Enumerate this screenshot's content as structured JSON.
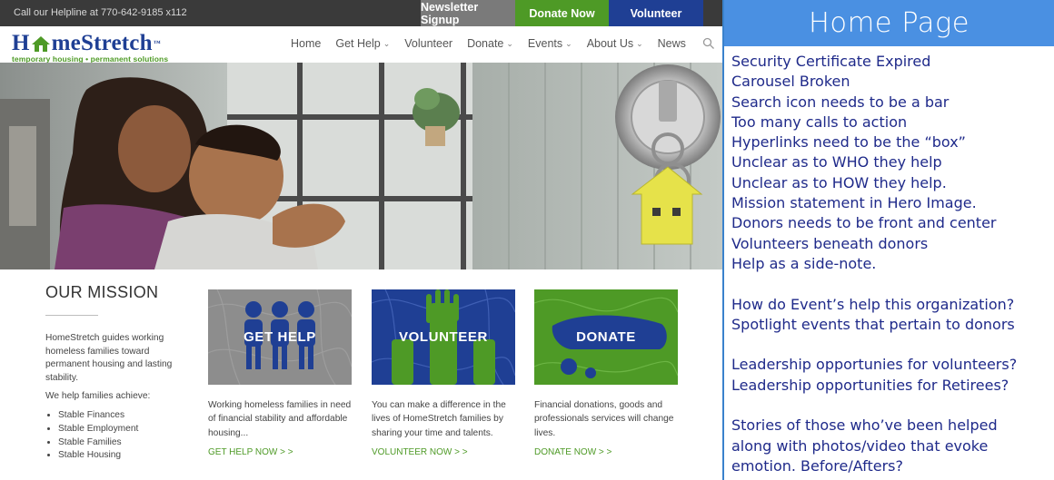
{
  "site": {
    "topbar": {
      "helpline": "Call our Helpline at 770-642-9185 x112",
      "newsletter_label": "Newsletter Signup",
      "donate_label": "Donate Now",
      "volunteer_label": "Volunteer"
    },
    "logo": {
      "word_prefix": "H",
      "word_suffix": "meStretch",
      "tm": "™",
      "tagline": "temporary housing • permanent solutions"
    },
    "nav": [
      {
        "label": "Home",
        "dropdown": false
      },
      {
        "label": "Get Help",
        "dropdown": true
      },
      {
        "label": "Volunteer",
        "dropdown": false
      },
      {
        "label": "Donate",
        "dropdown": true
      },
      {
        "label": "Events",
        "dropdown": true
      },
      {
        "label": "About Us",
        "dropdown": true
      },
      {
        "label": "News",
        "dropdown": false
      }
    ],
    "mission": {
      "title": "OUR MISSION",
      "paragraph": "HomeStretch guides working homeless families toward permanent housing and lasting stability.",
      "achieve_intro": "We help families achieve:",
      "items": [
        "Stable Finances",
        "Stable Employment",
        "Stable Families",
        "Stable Housing"
      ]
    },
    "cards": [
      {
        "image_label": "GET HELP",
        "text": "Working homeless families in need of financial stability and affordable housing...",
        "link": "GET HELP NOW > >"
      },
      {
        "image_label": "VOLUNTEER",
        "text": "You can make a difference in the lives of HomeStretch families by sharing your time and talents.",
        "link": "VOLUNTEER NOW > >"
      },
      {
        "image_label": "DONATE",
        "text": "Financial donations, goods and professionals services will change lives.",
        "link": "DONATE NOW > >"
      }
    ],
    "colors": {
      "brand_blue": "#1f3f94",
      "brand_green": "#4e9a26",
      "topbar": "#3a3a3a"
    }
  },
  "notes": {
    "title": "Home Page",
    "lines": [
      "Security Certificate Expired",
      "Carousel Broken",
      "Search icon needs to be a bar",
      "Too many calls to action",
      "Hyperlinks need to be the “box”",
      "Unclear as to WHO they help",
      "Unclear as to HOW they help.",
      "Mission statement in Hero Image.",
      "Donors needs to be front and center",
      "Volunteers beneath donors",
      "Help as a side-note.",
      "",
      "How do Event’s help this organization?",
      "Spotlight events that pertain to donors",
      "",
      "Leadership opportunies for volunteers?",
      "Leadership opportunities for Retirees?",
      "",
      "Stories of those who’ve been helped",
      "along with photos/video that evoke",
      "emotion. Before/Afters?"
    ],
    "colors": {
      "header_bg": "#4a90e2",
      "text": "#1f2a8a",
      "border": "#3a82cc"
    }
  }
}
